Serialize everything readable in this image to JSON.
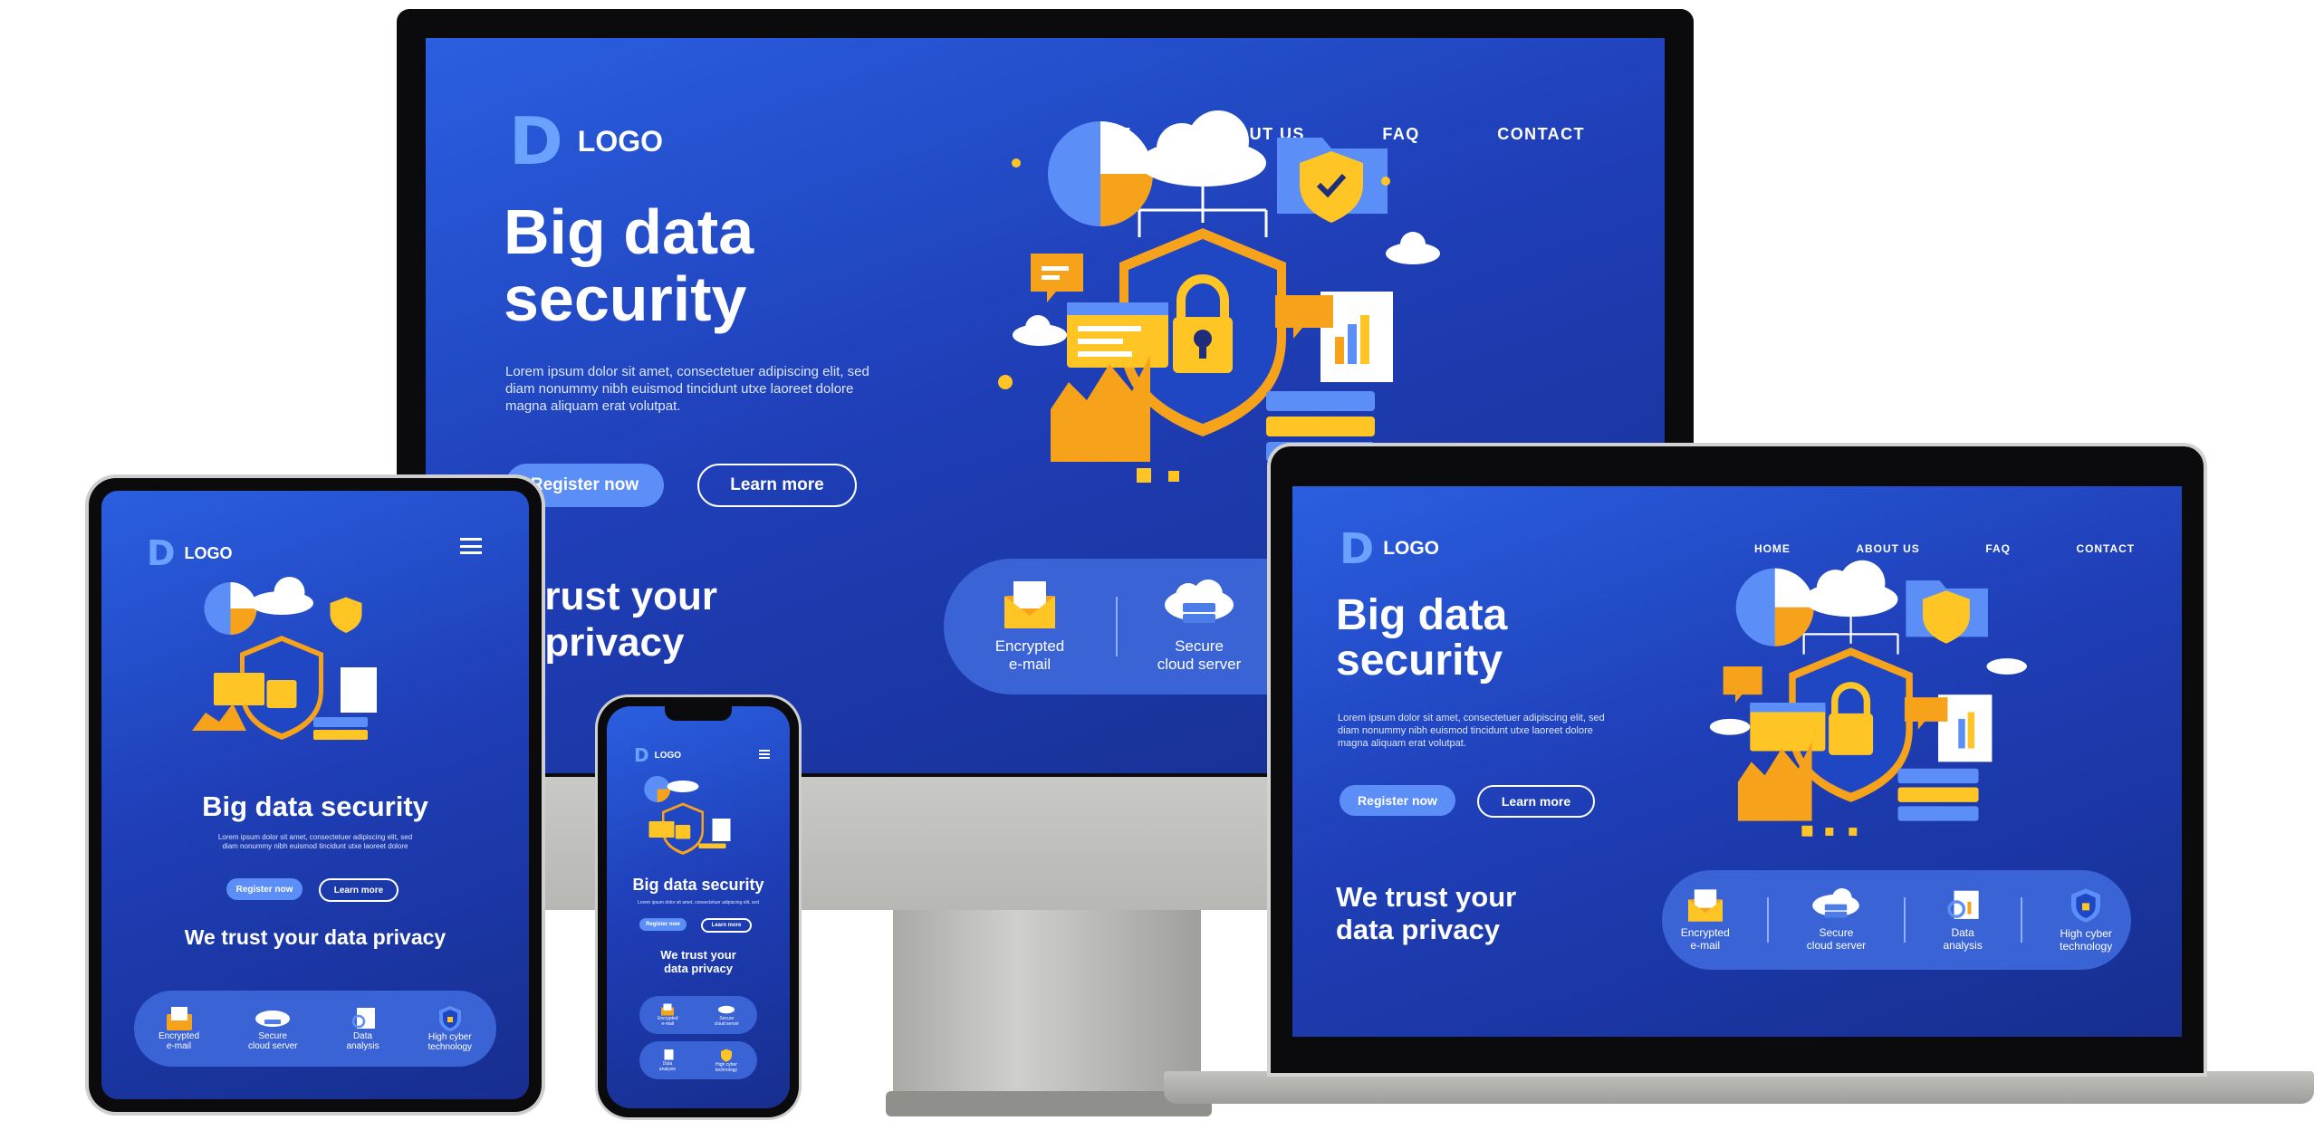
{
  "brand": {
    "mark": "D",
    "name": "LOGO"
  },
  "nav": [
    "HOME",
    "ABOUT US",
    "FAQ",
    "CONTACT"
  ],
  "hero": {
    "title_line1": "Big data",
    "title_line2": "security",
    "title_single": "Big data security",
    "body_line1": "Lorem ipsum dolor sit amet, consectetuer adipiscing elit, sed",
    "body_line2": "diam nonummy nibh euismod tincidunt utxe laoreet dolore",
    "body_line3": "magna aliquam erat volutpat."
  },
  "buttons": {
    "register": "Register now",
    "learn": "Learn more"
  },
  "trust": {
    "line1": "We trust your",
    "line2": "data privacy",
    "single": "We trust your data privacy",
    "clip_line1": "e trust your",
    "clip_line2": "ta privacy"
  },
  "features": [
    {
      "l1": "Encrypted",
      "l2": "e-mail",
      "icon": "envelope-icon"
    },
    {
      "l1": "Secure",
      "l2": "cloud server",
      "icon": "cloud-server-icon"
    },
    {
      "l1": "Data",
      "l2": "analysis",
      "icon": "data-analysis-icon"
    },
    {
      "l1": "High cyber",
      "l2": "technology",
      "icon": "shield-icon"
    }
  ],
  "colors": {
    "accent": "#5b8ff7",
    "brand_blue": "#1f3fb8",
    "orange": "#f6a21a",
    "yellow": "#ffc524"
  }
}
